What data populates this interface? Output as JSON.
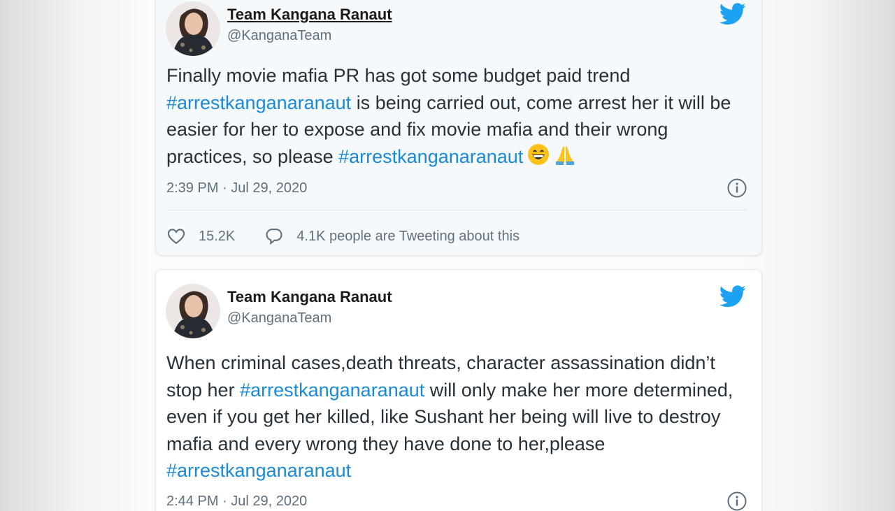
{
  "colors": {
    "link": "#1a8ad6",
    "twitter_brand": "#1da1f2",
    "muted_text": "#5f6f7d"
  },
  "tweets": [
    {
      "display_name": "Team Kangana Ranaut",
      "handle": "@KanganaTeam",
      "body": [
        {
          "text": "Finally movie mafia PR has got some budget paid trend "
        },
        {
          "text": "#arrestkanganaranaut",
          "hashtag": true
        },
        {
          "text": " is being carried out, come arrest her it will be easier for her to expose and fix movie mafia and their wrong practices, so please "
        },
        {
          "text": "#arrestkanganaranaut",
          "hashtag": true
        }
      ],
      "emojis": [
        "grinning-face-emoji",
        "folded-hands-emoji"
      ],
      "timestamp": "2:39 PM · Jul 29, 2020",
      "likes": "15.2K",
      "tweeting_text": "4.1K people are Tweeting about this",
      "icons": [
        "twitter-bird-icon",
        "info-icon",
        "heart-icon",
        "speech-bubble-icon"
      ]
    },
    {
      "display_name": "Team Kangana Ranaut",
      "handle": "@KanganaTeam",
      "body": [
        {
          "text": "When criminal cases,death threats, character assassination didn’t stop her "
        },
        {
          "text": "#arrestkanganaranaut",
          "hashtag": true
        },
        {
          "text": " will only make her more determined, even if you get her killed, like Sushant her being will live to destroy mafia and every wrong they have done to her,please "
        },
        {
          "text": "#arrestkanganaranaut",
          "hashtag": true
        }
      ],
      "timestamp": "2:44 PM · Jul 29, 2020",
      "icons": [
        "twitter-bird-icon",
        "info-icon"
      ]
    }
  ]
}
